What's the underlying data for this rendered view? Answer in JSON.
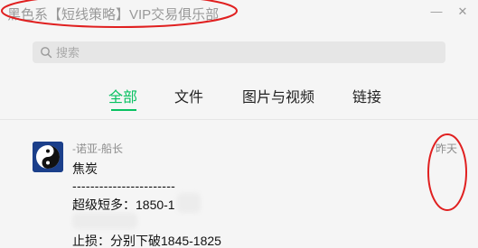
{
  "window": {
    "title": "黑色系【短线策略】VIP交易俱乐部",
    "minimize_glyph": "—",
    "close_glyph": "✕"
  },
  "search": {
    "placeholder": "搜索",
    "value": ""
  },
  "tabs": [
    {
      "label": "全部",
      "active": true
    },
    {
      "label": "文件",
      "active": false
    },
    {
      "label": "图片与视频",
      "active": false
    },
    {
      "label": "链接",
      "active": false
    }
  ],
  "message": {
    "sender": "-诺亚-船长",
    "timestamp": "昨天",
    "lines": [
      "焦炭",
      "-----------------------",
      "超级短多：1850-1",
      "",
      "止损：分别下破1845-1825"
    ]
  },
  "colors": {
    "accent": "#07c160",
    "annotation": "#e02020",
    "avatar_bg": "#1b3f8a"
  },
  "icons": {
    "search": "search-icon",
    "avatar": "yin-yang-icon"
  }
}
